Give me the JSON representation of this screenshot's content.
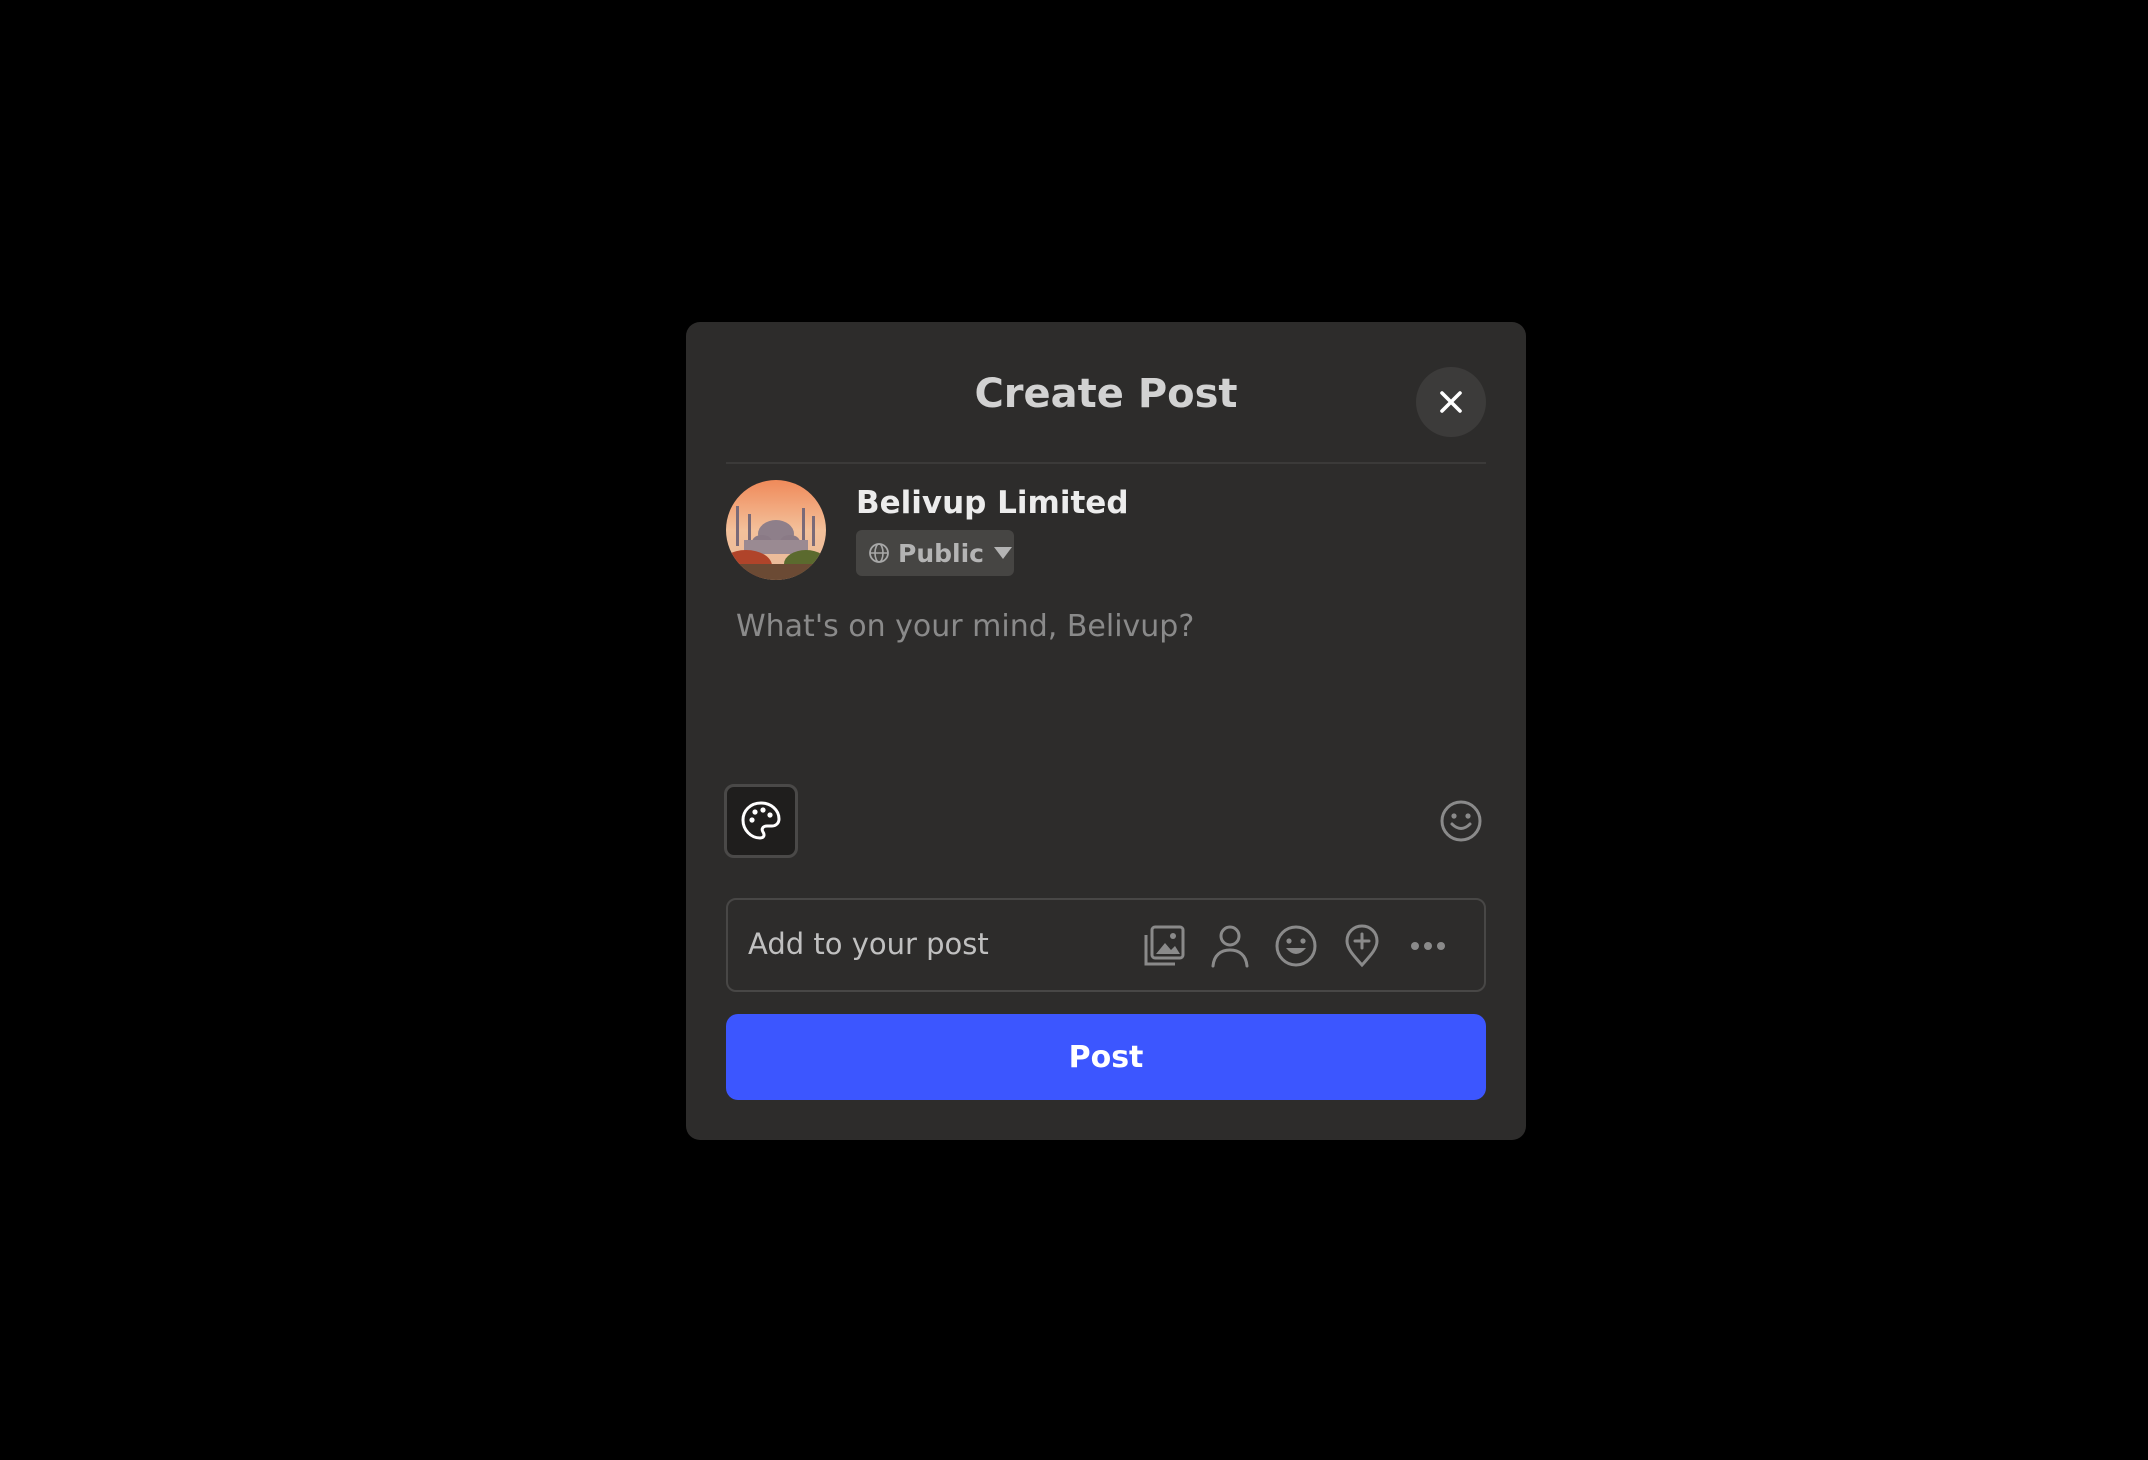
{
  "modal": {
    "title": "Create Post",
    "close_icon": "close-icon"
  },
  "user": {
    "name": "Belivup Limited",
    "avatar_icon": "avatar-mosque-photo",
    "audience": {
      "label": "Public",
      "icon": "globe-icon",
      "dropdown_icon": "caret-down-icon"
    }
  },
  "composer": {
    "placeholder": "What's on your mind, Belivup?",
    "background_icon": "palette-icon",
    "emoji_icon": "smiley-icon"
  },
  "add_to_post": {
    "label": "Add to your post",
    "icons": [
      "photo-gallery-icon",
      "tag-person-icon",
      "feeling-icon",
      "location-pin-icon",
      "more-icon"
    ]
  },
  "post_button": {
    "label": "Post",
    "color": "#3c56ff"
  },
  "colors": {
    "backdrop": "#000000",
    "modal": "#2d2c2b"
  }
}
